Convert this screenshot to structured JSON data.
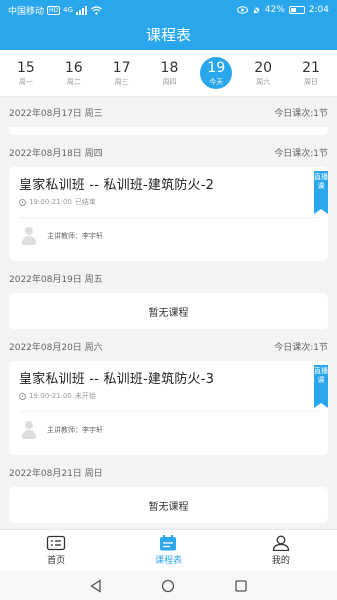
{
  "status_bar": {
    "carrier": "中国移动",
    "hd": "HD",
    "network": "4G",
    "battery": "42%",
    "time": "2:04"
  },
  "header": {
    "title": "课程表"
  },
  "week": [
    {
      "num": "15",
      "label": "周一",
      "active": false
    },
    {
      "num": "16",
      "label": "周二",
      "active": false
    },
    {
      "num": "17",
      "label": "周三",
      "active": false
    },
    {
      "num": "18",
      "label": "周四",
      "active": false
    },
    {
      "num": "19",
      "label": "今天",
      "active": true
    },
    {
      "num": "20",
      "label": "周六",
      "active": false
    },
    {
      "num": "21",
      "label": "周日",
      "active": false
    }
  ],
  "schedule": {
    "d17": {
      "date": "2022年08月17日 周三",
      "count": "今日课次:1节"
    },
    "d18": {
      "date": "2022年08月18日 周四",
      "count": "今日课次:1节",
      "title": "皇家私训班 -- 私训班-建筑防火-2",
      "time": "19:00-21:00",
      "status": "已结束",
      "tag": "直播课",
      "teacher_label": "主讲教师：",
      "teacher": "李宇轩"
    },
    "d19": {
      "date": "2022年08月19日 周五",
      "empty": "暂无课程"
    },
    "d20": {
      "date": "2022年08月20日 周六",
      "count": "今日课次:1节",
      "title": "皇家私训班 -- 私训班-建筑防火-3",
      "time": "19:00-21:00",
      "status": "未开始",
      "tag": "直播课",
      "teacher_label": "主讲教师：",
      "teacher": "李宇轩"
    },
    "d21": {
      "date": "2022年08月21日 周日",
      "empty": "暂无课程"
    }
  },
  "tabs": {
    "home": "首页",
    "schedule": "课程表",
    "mine": "我的"
  },
  "colors": {
    "accent": "#2aa7ec"
  }
}
